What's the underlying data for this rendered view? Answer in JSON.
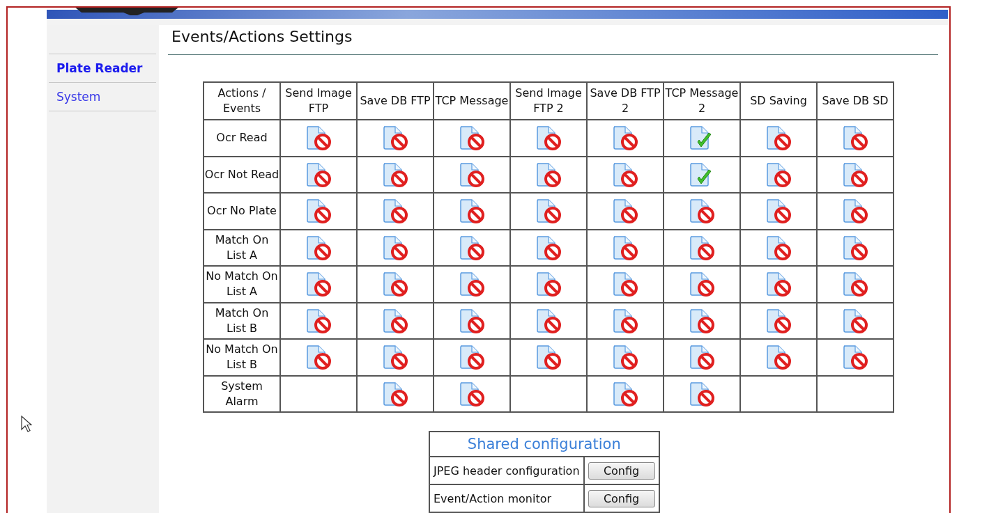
{
  "sidebar": {
    "items": [
      {
        "label": "Plate Reader",
        "selected": true
      },
      {
        "label": "System",
        "selected": false
      }
    ]
  },
  "title": "Events/Actions Settings",
  "table": {
    "corner": "Actions / Events",
    "columns": [
      "Send Image FTP",
      "Save DB FTP",
      "TCP Message",
      "Send Image FTP 2",
      "Save DB FTP 2",
      "TCP Message 2",
      "SD Saving",
      "Save DB SD"
    ],
    "rows": [
      {
        "event": "Ocr Read",
        "cells": [
          {
            "kind": "icon",
            "enabled": false
          },
          {
            "kind": "icon",
            "enabled": false
          },
          {
            "kind": "icon",
            "enabled": false
          },
          {
            "kind": "icon",
            "enabled": false
          },
          {
            "kind": "icon",
            "enabled": false
          },
          {
            "kind": "icon",
            "enabled": true
          },
          {
            "kind": "icon",
            "enabled": false
          },
          {
            "kind": "icon",
            "enabled": false
          }
        ]
      },
      {
        "event": "Ocr Not Read",
        "cells": [
          {
            "kind": "icon",
            "enabled": false
          },
          {
            "kind": "icon",
            "enabled": false
          },
          {
            "kind": "icon",
            "enabled": false
          },
          {
            "kind": "icon",
            "enabled": false
          },
          {
            "kind": "icon",
            "enabled": false
          },
          {
            "kind": "icon",
            "enabled": true
          },
          {
            "kind": "icon",
            "enabled": false
          },
          {
            "kind": "icon",
            "enabled": false
          }
        ]
      },
      {
        "event": "Ocr No Plate",
        "cells": [
          {
            "kind": "icon",
            "enabled": false
          },
          {
            "kind": "icon",
            "enabled": false
          },
          {
            "kind": "icon",
            "enabled": false
          },
          {
            "kind": "icon",
            "enabled": false
          },
          {
            "kind": "icon",
            "enabled": false
          },
          {
            "kind": "icon",
            "enabled": false
          },
          {
            "kind": "icon",
            "enabled": false
          },
          {
            "kind": "icon",
            "enabled": false
          }
        ]
      },
      {
        "event": "Match On List A",
        "cells": [
          {
            "kind": "icon",
            "enabled": false
          },
          {
            "kind": "icon",
            "enabled": false
          },
          {
            "kind": "icon",
            "enabled": false
          },
          {
            "kind": "icon",
            "enabled": false
          },
          {
            "kind": "icon",
            "enabled": false
          },
          {
            "kind": "icon",
            "enabled": false
          },
          {
            "kind": "icon",
            "enabled": false
          },
          {
            "kind": "icon",
            "enabled": false
          }
        ]
      },
      {
        "event": "No Match On List A",
        "cells": [
          {
            "kind": "icon",
            "enabled": false
          },
          {
            "kind": "icon",
            "enabled": false
          },
          {
            "kind": "icon",
            "enabled": false
          },
          {
            "kind": "icon",
            "enabled": false
          },
          {
            "kind": "icon",
            "enabled": false
          },
          {
            "kind": "icon",
            "enabled": false
          },
          {
            "kind": "icon",
            "enabled": false
          },
          {
            "kind": "icon",
            "enabled": false
          }
        ]
      },
      {
        "event": "Match On List B",
        "cells": [
          {
            "kind": "icon",
            "enabled": false
          },
          {
            "kind": "icon",
            "enabled": false
          },
          {
            "kind": "icon",
            "enabled": false
          },
          {
            "kind": "icon",
            "enabled": false
          },
          {
            "kind": "icon",
            "enabled": false
          },
          {
            "kind": "icon",
            "enabled": false
          },
          {
            "kind": "icon",
            "enabled": false
          },
          {
            "kind": "icon",
            "enabled": false
          }
        ]
      },
      {
        "event": "No Match On List B",
        "cells": [
          {
            "kind": "icon",
            "enabled": false
          },
          {
            "kind": "icon",
            "enabled": false
          },
          {
            "kind": "icon",
            "enabled": false
          },
          {
            "kind": "icon",
            "enabled": false
          },
          {
            "kind": "icon",
            "enabled": false
          },
          {
            "kind": "icon",
            "enabled": false
          },
          {
            "kind": "icon",
            "enabled": false
          },
          {
            "kind": "icon",
            "enabled": false
          }
        ]
      },
      {
        "event": "System Alarm",
        "cells": [
          {
            "kind": "empty"
          },
          {
            "kind": "icon",
            "enabled": false
          },
          {
            "kind": "icon",
            "enabled": false
          },
          {
            "kind": "empty"
          },
          {
            "kind": "icon",
            "enabled": false
          },
          {
            "kind": "icon",
            "enabled": false
          },
          {
            "kind": "empty"
          },
          {
            "kind": "empty"
          }
        ]
      }
    ]
  },
  "shared": {
    "title": "Shared configuration",
    "rows": [
      {
        "label": "JPEG header configuration",
        "button": "Config"
      },
      {
        "label": "Event/Action monitor",
        "button": "Config"
      }
    ]
  }
}
